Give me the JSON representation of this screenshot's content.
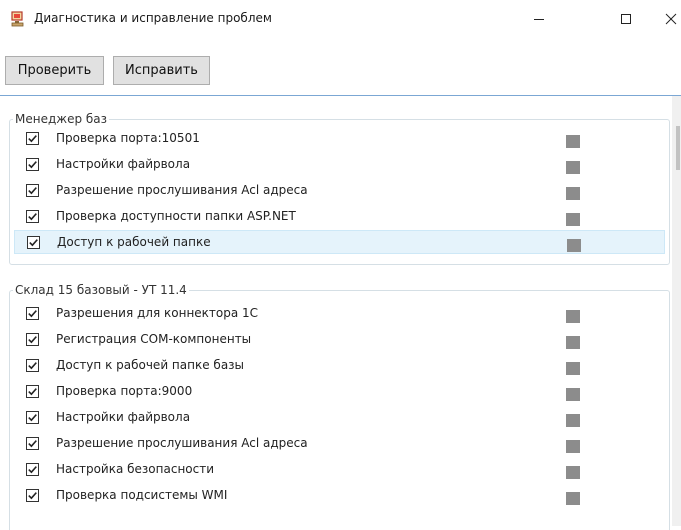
{
  "window": {
    "title": "Диагностика и исправление проблем",
    "icon": "computer-repair-icon",
    "controls": {
      "minimize": "—",
      "maximize": "☐",
      "close": "✕"
    }
  },
  "toolbar": {
    "check_label": "Проверить",
    "fix_label": "Исправить"
  },
  "groups": [
    {
      "title": "Менеджер баз",
      "items": [
        {
          "label": "Проверка порта:10501",
          "checked": true
        },
        {
          "label": "Настройки файрвола",
          "checked": true
        },
        {
          "label": "Разрешение прослушивания Acl адреса",
          "checked": true
        },
        {
          "label": "Проверка доступности папки ASP.NET",
          "checked": true
        },
        {
          "label": "Доступ к рабочей папке",
          "checked": true,
          "selected": true
        }
      ]
    },
    {
      "title": "Склад 15 базовый - УТ 11.4",
      "items": [
        {
          "label": "Разрешения для коннектора 1С",
          "checked": true
        },
        {
          "label": "Регистрация COM-компоненты",
          "checked": true
        },
        {
          "label": "Доступ к рабочей папке базы",
          "checked": true
        },
        {
          "label": "Проверка порта:9000",
          "checked": true
        },
        {
          "label": "Настройки файрвола",
          "checked": true
        },
        {
          "label": "Разрешение прослушивания Acl адреса",
          "checked": true
        },
        {
          "label": "Настройка безопасности",
          "checked": true
        },
        {
          "label": "Проверка подсистемы WMI",
          "checked": true
        }
      ]
    }
  ],
  "colors": {
    "status_indicator": "#8c8c8c",
    "selected_row": "#e5f3fb",
    "separator": "#7ba7d4"
  }
}
